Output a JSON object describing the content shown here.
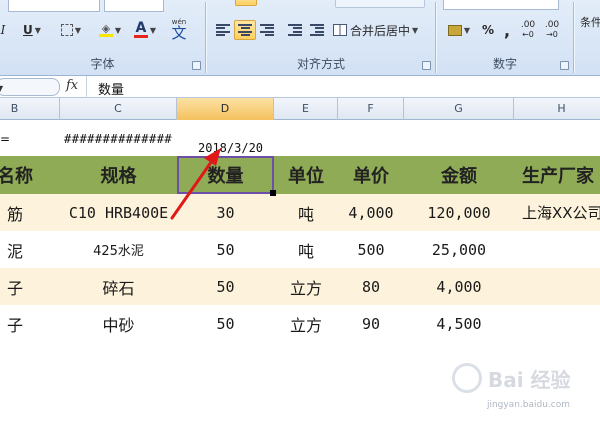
{
  "ribbon": {
    "font_group": {
      "label": "字体",
      "underline_label": "U",
      "wen_label": "wén"
    },
    "align_group": {
      "label": "对齐方式",
      "merge_label": "合并后居中"
    },
    "number_group": {
      "label": "数字",
      "percent_label": "%",
      "comma_label": ",",
      "inc_decimal_label": ".00",
      "dec_decimal_label": ".00",
      "format_label": ""
    },
    "styles_group": {
      "cond_label": "条件"
    },
    "font_color": "#e8251d",
    "fill_color": "#f7e600"
  },
  "formula_bar": {
    "fx_label": "fx",
    "content": "数量"
  },
  "columns": [
    {
      "letter": "B"
    },
    {
      "letter": "C"
    },
    {
      "letter": "D",
      "active": true
    },
    {
      "letter": "E"
    },
    {
      "letter": "F"
    },
    {
      "letter": "G"
    },
    {
      "letter": "H"
    }
  ],
  "sheet": {
    "b_cell": "=",
    "hash_cell": "##############",
    "date_cell": "2018/3/20",
    "headers": [
      "名称",
      "规格",
      "数量",
      "单位",
      "单价",
      "金额",
      "生产厂家"
    ],
    "rows": [
      [
        "筋",
        "C10 HRB400E",
        "30",
        "吨",
        "4,000",
        "120,000",
        "上海XX公司"
      ],
      [
        "泥",
        "425水泥",
        "50",
        "吨",
        "500",
        "25,000",
        ""
      ],
      [
        "子",
        "碎石",
        "50",
        "立方",
        "80",
        "4,000",
        ""
      ],
      [
        "子",
        "中砂",
        "50",
        "立方",
        "90",
        "4,500",
        ""
      ]
    ],
    "header_color": "#8fab55",
    "band_color": "#fdf3dc"
  },
  "watermark": {
    "text": "Bai 经验",
    "url": "jingyan.baidu.com"
  }
}
